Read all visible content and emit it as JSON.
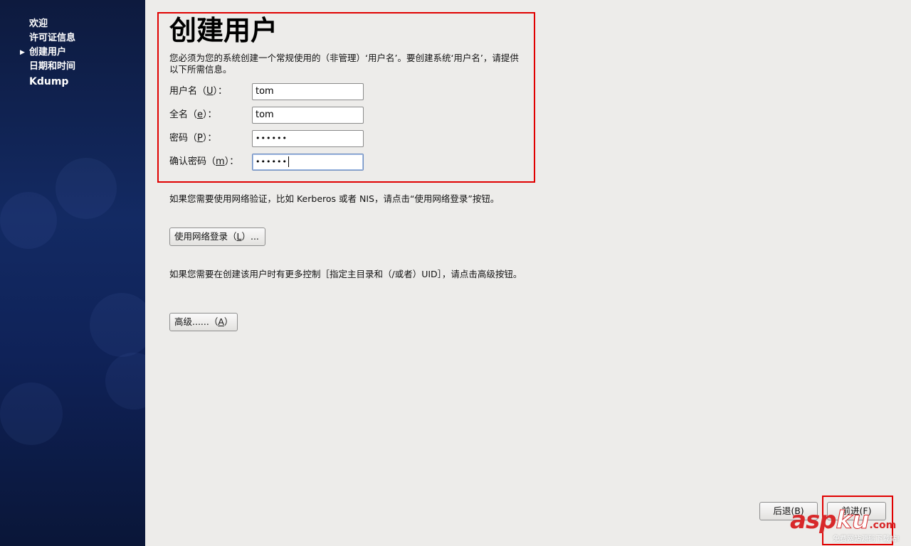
{
  "sidebar": {
    "steps": [
      {
        "label": "欢迎"
      },
      {
        "label": "许可证信息"
      },
      {
        "label": "创建用户",
        "current": true
      },
      {
        "label": "日期和时间"
      },
      {
        "label": "Kdump"
      }
    ]
  },
  "page": {
    "title": "创建用户",
    "description": "您必须为您的系统创建一个常规使用的（非管理）‘用户名’。要创建系统‘用户名’，请提供以下所需信息。"
  },
  "form": {
    "username": {
      "label_pre": "用户名（",
      "label_key": "U",
      "label_post": "）：",
      "value": "tom"
    },
    "fullname": {
      "label_pre": "全名（",
      "label_key": "e",
      "label_post": "）：",
      "value": "tom"
    },
    "password": {
      "label_pre": "密码（",
      "label_key": "P",
      "label_post": "）：",
      "value": "••••••"
    },
    "confirm": {
      "label_pre": "确认密码（",
      "label_key": "m",
      "label_post": "）：",
      "value": "••••••"
    }
  },
  "network": {
    "info": "如果您需要使用网络验证，比如 Kerberos 或者 NIS，请点击“使用网络登录”按钮。",
    "button_pre": "使用网络登录（",
    "button_key": "L",
    "button_post": "）..."
  },
  "advanced": {
    "info": "如果您需要在创建该用户时有更多控制［指定主目录和（/或者）UID］，请点击高级按钮。",
    "button_pre": "高级......（",
    "button_key": "A",
    "button_post": "）"
  },
  "nav": {
    "back_label": "后退(B)",
    "forward_label": "前进(F)"
  },
  "watermark": {
    "brand_a": "asp",
    "brand_b": "ku",
    "brand_c": ".com",
    "tagline": "免费网站源码下载站!"
  },
  "colors": {
    "sidebar_bg": "#132a63",
    "highlight": "#e00000",
    "window_bg": "#edecea"
  }
}
